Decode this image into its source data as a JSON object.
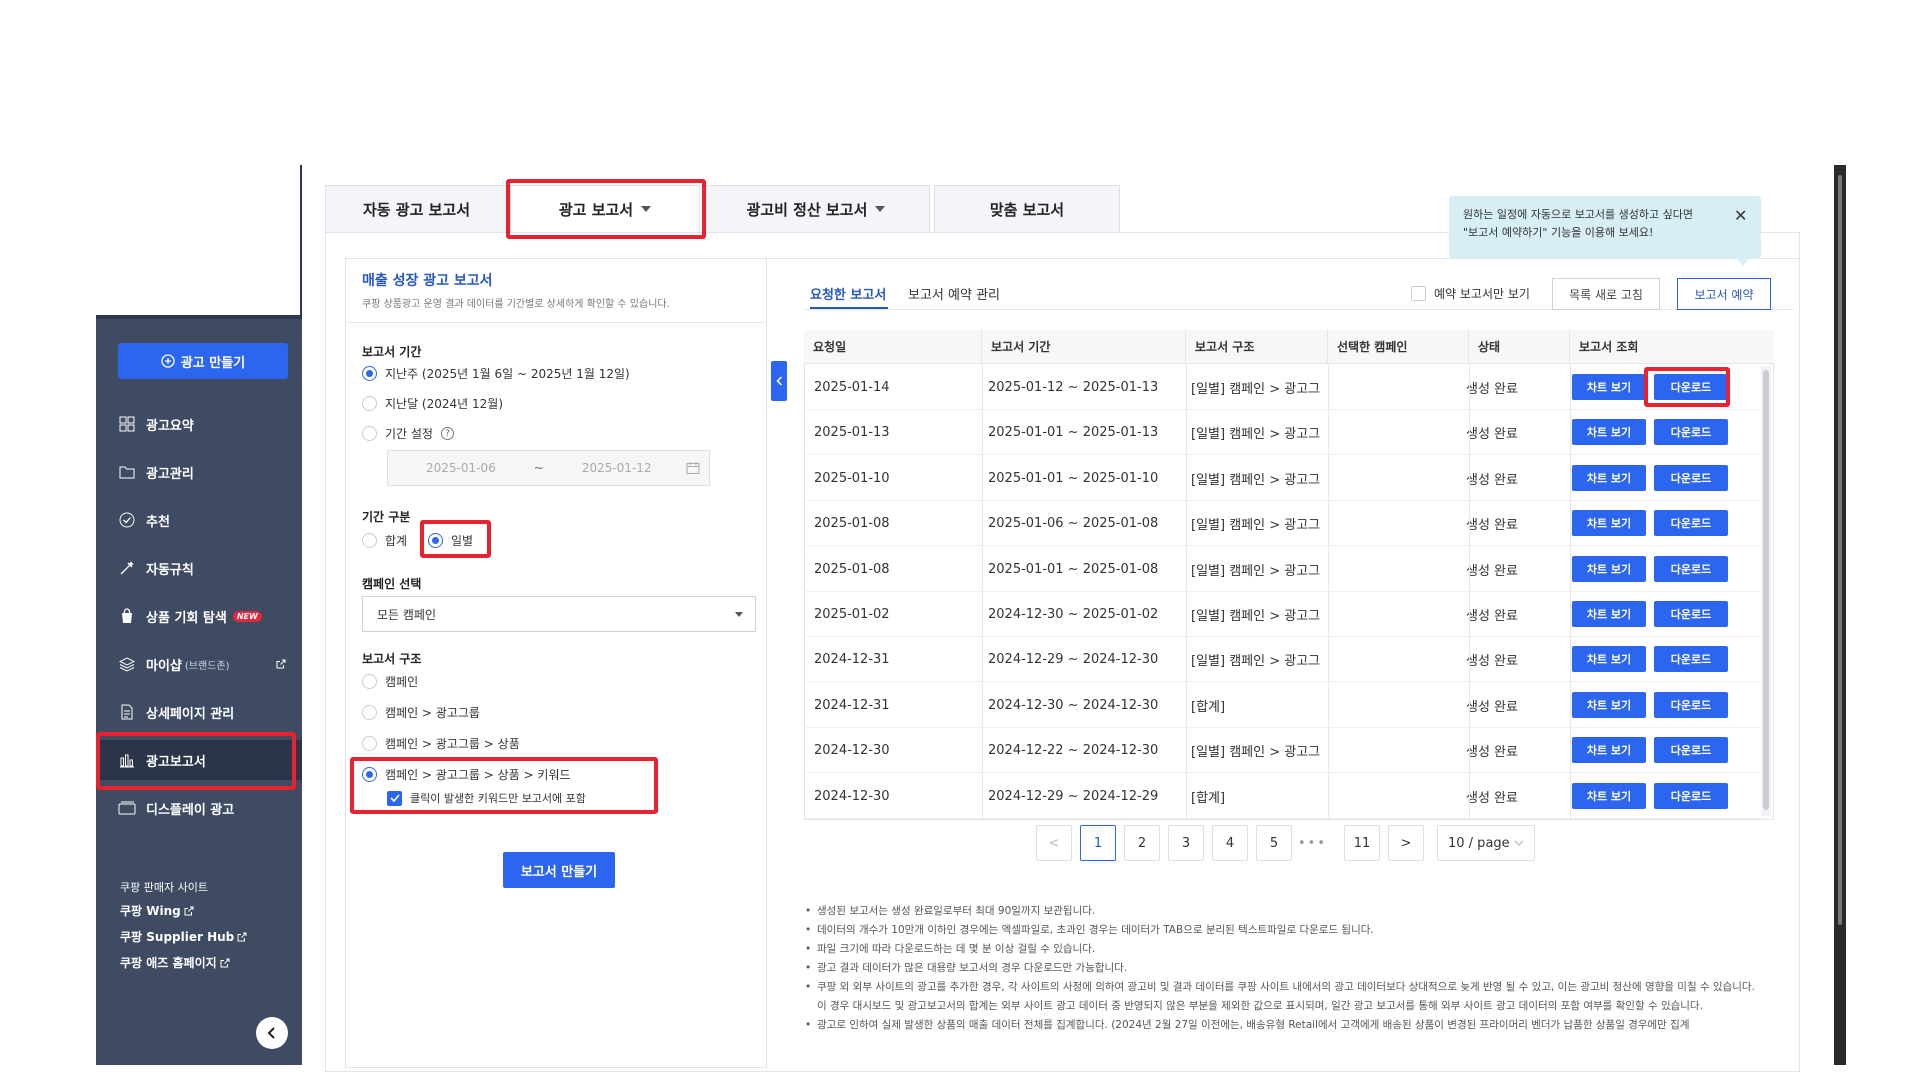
{
  "sidebar": {
    "create_button": "광고 만들기",
    "items": [
      {
        "label": "광고요약",
        "icon": "grid-icon"
      },
      {
        "label": "광고관리",
        "icon": "folder-icon"
      },
      {
        "label": "추천",
        "icon": "check-circle-icon"
      },
      {
        "label": "자동규칙",
        "icon": "wand-icon"
      },
      {
        "label": "상품 기회 탐색",
        "icon": "bag-icon",
        "badge": "NEW"
      },
      {
        "label": "마이샵",
        "sub": "(브랜드존)",
        "icon": "layers-icon"
      },
      {
        "label": "상세페이지 관리",
        "icon": "document-icon"
      },
      {
        "label": "광고보고서",
        "icon": "bar-chart-icon"
      },
      {
        "label": "디스플레이 광고",
        "icon": "card-icon"
      }
    ],
    "seller_sites_label": "쿠팡 판매자 사이트",
    "links": [
      "쿠팡 Wing",
      "쿠팡 Supplier Hub",
      "쿠팡 애즈 홈페이지"
    ]
  },
  "tabs": [
    {
      "label": "자동 광고 보고서",
      "caret": false
    },
    {
      "label": "광고 보고서",
      "caret": true
    },
    {
      "label": "광고비 정산 보고서",
      "caret": true
    },
    {
      "label": "맞춤 보고서",
      "caret": false
    }
  ],
  "form": {
    "title": "매출 성장 광고 보고서",
    "description": "쿠팡 상품광고 운영 결과 데이터를 기간별로 상세하게 확인할 수 있습니다.",
    "period_label": "보고서 기간",
    "period_options": [
      "지난주 (2025년 1월 6일 ~ 2025년 1월 12일)",
      "지난달 (2024년 12월)",
      "기간 설정"
    ],
    "date_from": "2025-01-06",
    "date_sep": "~",
    "date_to": "2025-01-12",
    "period_type_label": "기간 구분",
    "period_type_options": [
      "합계",
      "일별"
    ],
    "campaign_label": "캠페인 선택",
    "campaign_value": "모든 캠페인",
    "structure_label": "보고서 구조",
    "structure_options": [
      "캠페인",
      "캠페인 > 광고그룹",
      "캠페인 > 광고그룹 > 상품",
      "캠페인 > 광고그룹 > 상품 > 키워드"
    ],
    "keyword_checkbox": "클릭이 발생한 키워드만 보고서에 포함",
    "submit": "보고서 만들기"
  },
  "right": {
    "tab_requested": "요청한 보고서",
    "tab_schedule": "보고서 예약 관리",
    "only_scheduled": "예약 보고서만 보기",
    "refresh_button": "목록 새로 고침",
    "schedule_button": "보고서 예약",
    "tooltip_line1": "원하는 일정에 자동으로 보고서를 생성하고 싶다면",
    "tooltip_line2": "\"보고서 예약하기\" 기능을 이용해 보세요!",
    "tooltip_close": "✕"
  },
  "table": {
    "headers": [
      "요청일",
      "보고서 기간",
      "보고서 구조",
      "선택한 캠페인",
      "상태",
      "보고서 조회"
    ],
    "chart_btn": "차트 보기",
    "download_btn": "다운로드",
    "rows": [
      {
        "date": "2025-01-14",
        "period": "2025-01-12 ~ 2025-01-13",
        "structure": "[일별] 캠페인 > 광고그",
        "status": "생성 완료"
      },
      {
        "date": "2025-01-13",
        "period": "2025-01-01 ~ 2025-01-13",
        "structure": "[일별] 캠페인 > 광고그",
        "status": "생성 완료"
      },
      {
        "date": "2025-01-10",
        "period": "2025-01-01 ~ 2025-01-10",
        "structure": "[일별] 캠페인 > 광고그",
        "status": "생성 완료"
      },
      {
        "date": "2025-01-08",
        "period": "2025-01-06 ~ 2025-01-08",
        "structure": "[일별] 캠페인 > 광고그",
        "status": "생성 완료"
      },
      {
        "date": "2025-01-08",
        "period": "2025-01-01 ~ 2025-01-08",
        "structure": "[일별] 캠페인 > 광고그",
        "status": "생성 완료"
      },
      {
        "date": "2025-01-02",
        "period": "2024-12-30 ~ 2025-01-02",
        "structure": "[일별] 캠페인 > 광고그",
        "status": "생성 완료"
      },
      {
        "date": "2024-12-31",
        "period": "2024-12-29 ~ 2024-12-30",
        "structure": "[일별] 캠페인 > 광고그",
        "status": "생성 완료"
      },
      {
        "date": "2024-12-31",
        "period": "2024-12-30 ~ 2024-12-30",
        "structure": "[합계]",
        "status": "생성 완료"
      },
      {
        "date": "2024-12-30",
        "period": "2024-12-22 ~ 2024-12-30",
        "structure": "[일별] 캠페인 > 광고그",
        "status": "생성 완료"
      },
      {
        "date": "2024-12-30",
        "period": "2024-12-29 ~ 2024-12-29",
        "structure": "[합계]",
        "status": "생성 완료"
      }
    ]
  },
  "pagination": {
    "prev": "<",
    "pages": [
      "1",
      "2",
      "3",
      "4",
      "5"
    ],
    "dots": "•••",
    "last": "11",
    "next": ">",
    "page_size": "10 / page"
  },
  "notes": [
    "생성된 보고서는 생성 완료일로부터 최대 90일까지 보관됩니다.",
    "데이터의 개수가 10만개 이하인 경우에는 엑셀파일로, 초과인 경우는 데이터가 TAB으로 분리된 텍스트파일로 다운로드 됩니다.",
    "파일 크기에 따라 다운로드하는 데 몇 분 이상 걸릴 수 있습니다.",
    "광고 결과 데이터가 많은 대용량 보고서의 경우 다운로드만 가능합니다.",
    "쿠팡 외 외부 사이트의 광고를 추가한 경우, 각 사이트의 사정에 의하여 광고비 및 결과 데이터를 쿠팡 사이트 내에서의 광고 데이터보다 상대적으로 늦게 반영 될 수 있고, 이는 광고비 정산에 영향을 미칠 수 있습니다. 이 경우 대시보드 및 광고보고서의 합계는 외부 사이트 광고 데이터 중 반영되지 않은 부분을 제외한 값으로 표시되며, 일간 광고 보고서를 통해 외부 사이트 광고 데이터의 포함 여부를 확인할 수 있습니다.",
    "광고로 인하여 실제 발생한 상품의 매출 데이터 전체를 집계합니다. (2024년 2월 27일 이전에는, 배송유형 Retail에서 고객에게 배송된 상품이 변경된 프라이머리 벤더가 납품한 상품일 경우에만 집계"
  ],
  "colors": {
    "accent": "#2c66f0",
    "sidebar": "#3f4a63",
    "highlight": "#e8222f"
  }
}
